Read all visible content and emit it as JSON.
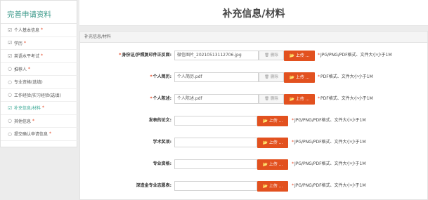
{
  "sidebar": {
    "title": "完善申请资料",
    "items": [
      {
        "label": "个人基本信息",
        "icon": "check-circle-icon",
        "required": "*"
      },
      {
        "label": "学历",
        "icon": "check-circle-icon",
        "required": "*"
      },
      {
        "label": "英语水平考试",
        "icon": "check-circle-icon",
        "required": "*"
      },
      {
        "label": "推荐人",
        "icon": "circle-icon",
        "required": "*"
      },
      {
        "label": "专业资格(选填)",
        "icon": "circle-icon",
        "required": ""
      },
      {
        "label": "工作经验/实习经验(选填)",
        "icon": "circle-icon",
        "required": ""
      },
      {
        "label": "补充信息/材料",
        "icon": "check-circle-icon",
        "required": "*",
        "active": true
      },
      {
        "label": "其他信息",
        "icon": "circle-icon",
        "required": "*"
      },
      {
        "label": "提交确认申请信息",
        "icon": "circle-icon",
        "required": "*"
      }
    ]
  },
  "header": {
    "title": "补充信息/材料"
  },
  "panel": {
    "heading": "补充信息/材料"
  },
  "common": {
    "delete_label": "删除",
    "upload_label": "上传 ..."
  },
  "rows": [
    {
      "label": "身份证/护照复印件正反面:",
      "required": "*",
      "file": "微信图片_20210513112706.jpg",
      "hint": "JPG/PNG/PDF格式、文件大小小于1M",
      "hint_required": "*"
    },
    {
      "label": "个人简历:",
      "required": "*",
      "file": "个人简历.pdf",
      "hint": "PDF格式、文件大小小于1M",
      "hint_required": "*"
    },
    {
      "label": "个人陈述:",
      "required": "*",
      "file": "个人陈述.pdf",
      "hint": "PDF格式、文件大小小于1M",
      "hint_required": "*"
    },
    {
      "label": "发表的论文:",
      "required": "",
      "file": "",
      "hint": "JPG/PNG/PDF格式、文件大小小于1M",
      "hint_required": "*"
    },
    {
      "label": "学术奖项:",
      "required": "",
      "file": "",
      "hint": "JPG/PNG/PDF格式、文件大小小于1M",
      "hint_required": "*"
    },
    {
      "label": "专业资格:",
      "required": "",
      "file": "",
      "hint": "JPG/PNG/PDF格式、文件大小小于1M",
      "hint_required": "*"
    },
    {
      "label": "深造金专业志愿表:",
      "required": "",
      "file": "",
      "hint": "JPG/PNG/PDF格式、文件大小小于1M",
      "hint_required": "*"
    }
  ],
  "colors": {
    "accent": "#3d9a8b",
    "upload": "#e2511f",
    "required": "#e2401d"
  }
}
